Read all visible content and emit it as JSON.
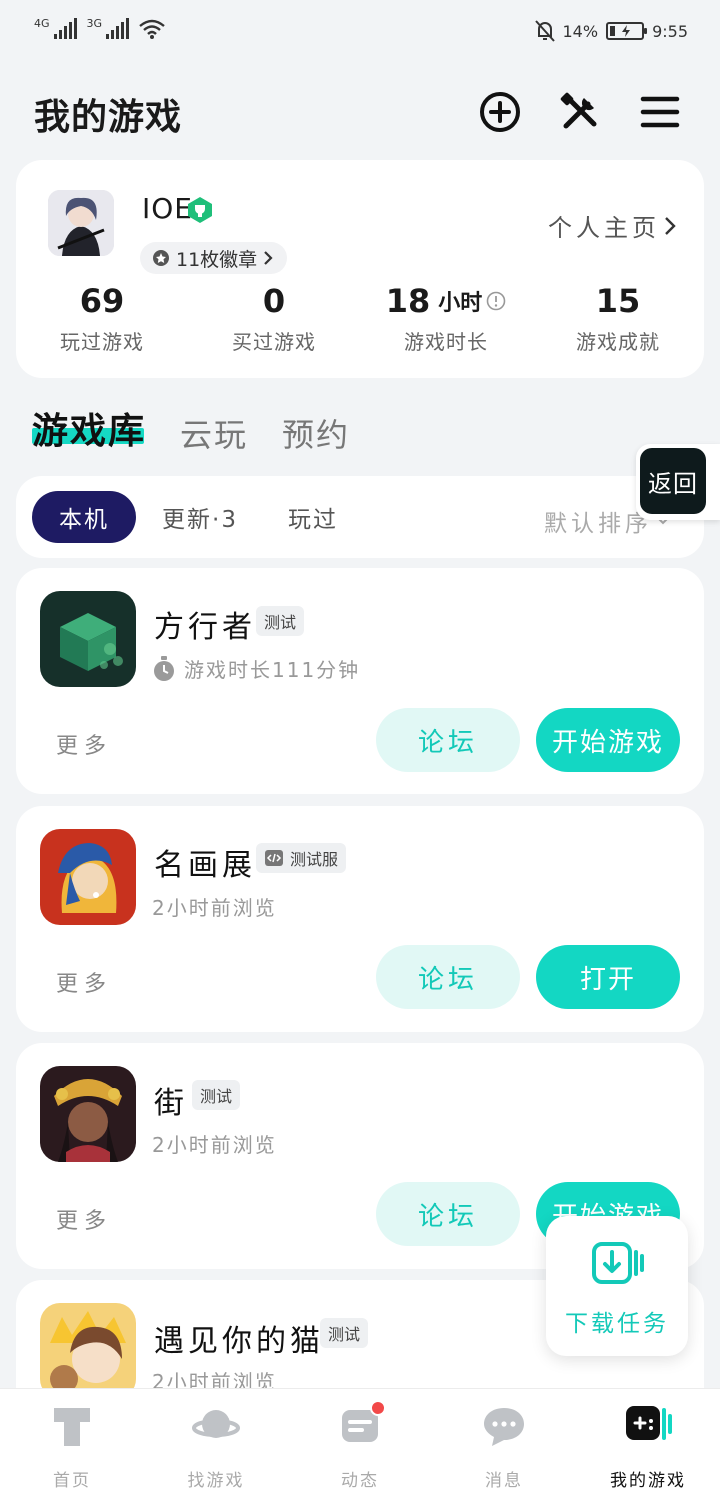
{
  "status_bar": {
    "net1": "4G",
    "net2": "3G",
    "battery_pct": "14%",
    "time": "9:55"
  },
  "header": {
    "title": "我的游戏",
    "icons": [
      "add-circle-icon",
      "tools-icon",
      "menu-icon"
    ]
  },
  "profile": {
    "username": "IOE",
    "badges_label": "11枚徽章",
    "homepage_label": "个人主页",
    "stats": [
      {
        "value": "69",
        "unit": "",
        "label": "玩过游戏"
      },
      {
        "value": "0",
        "unit": "",
        "label": "买过游戏"
      },
      {
        "value": "18",
        "unit": "小时",
        "label": "游戏时长"
      },
      {
        "value": "15",
        "unit": "",
        "label": "游戏成就"
      }
    ]
  },
  "library_tabs": [
    {
      "label": "游戏库",
      "active": true
    },
    {
      "label": "云玩",
      "active": false
    },
    {
      "label": "预约",
      "active": false
    }
  ],
  "return_button": {
    "label": "返回"
  },
  "filters": {
    "chips": [
      {
        "label": "本机",
        "active": true
      },
      {
        "label": "更新·3",
        "active": false
      },
      {
        "label": "玩过",
        "active": false
      }
    ],
    "sort_label": "默认排序"
  },
  "games": [
    {
      "name": "方行者",
      "tag": "测试",
      "subtitle": "游戏时长111分钟",
      "more": "更多",
      "forum": "论坛",
      "action": "开始游戏"
    },
    {
      "name": "名画展",
      "tag": "测试服",
      "subtitle": "2小时前浏览",
      "more": "更多",
      "forum": "论坛",
      "action": "打开"
    },
    {
      "name": "街",
      "tag": "测试",
      "subtitle": "2小时前浏览",
      "more": "更多",
      "forum": "论坛",
      "action": "开始游戏"
    },
    {
      "name": "遇见你的猫",
      "tag": "测试",
      "subtitle": "2小时前浏览"
    }
  ],
  "download_task": {
    "label": "下载任务"
  },
  "bottom_nav": [
    {
      "label": "首页",
      "icon": "home-t-icon",
      "active": false
    },
    {
      "label": "找游戏",
      "icon": "planet-icon",
      "active": false
    },
    {
      "label": "动态",
      "icon": "feed-icon",
      "active": false
    },
    {
      "label": "消息",
      "icon": "chat-bubble-icon",
      "active": false
    },
    {
      "label": "我的游戏",
      "icon": "gamepad-icon",
      "active": true
    }
  ],
  "colors": {
    "accent": "#13d7c3",
    "accent_light": "#e1f8f5",
    "chip_active": "#1e1b63",
    "badge_green": "#1fbf7a",
    "notify_red": "#f24949"
  }
}
